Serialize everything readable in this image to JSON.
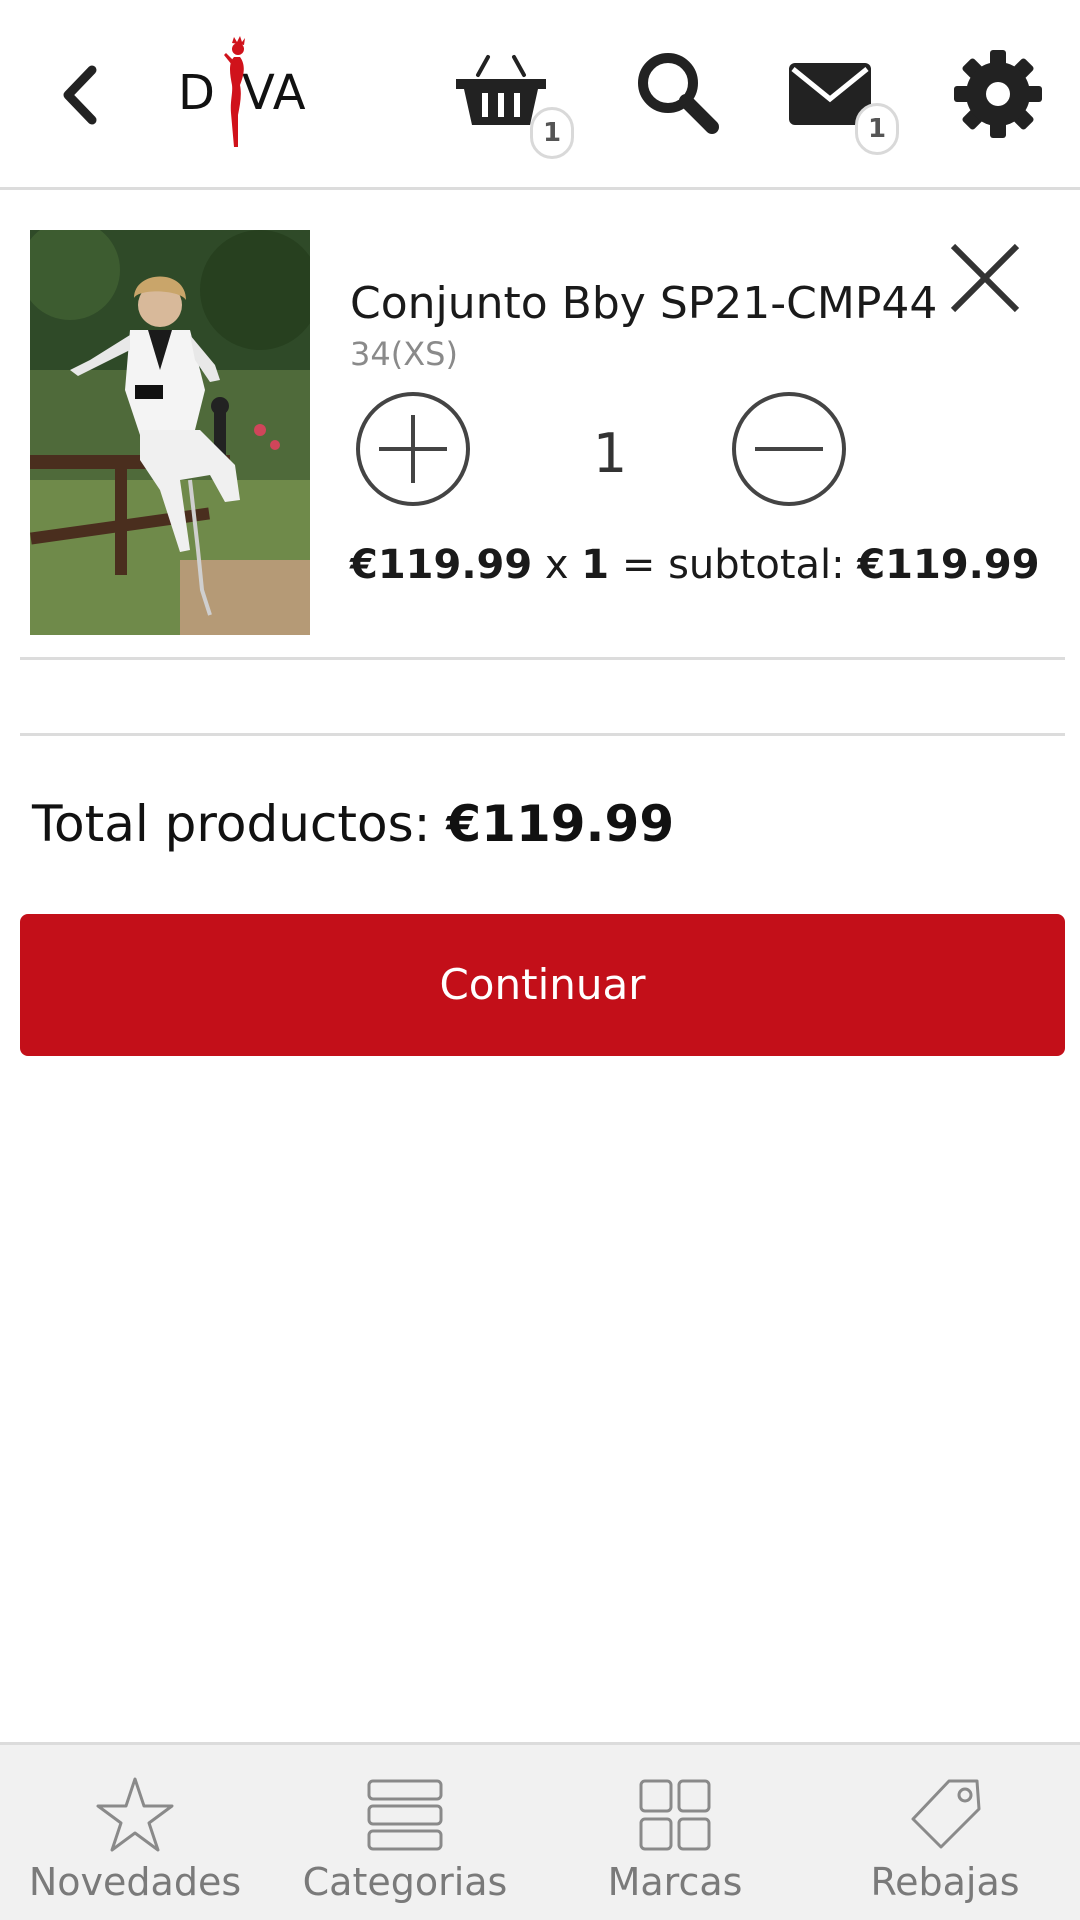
{
  "header": {
    "logo_text": [
      "D",
      "VA"
    ],
    "cart_badge": "1",
    "mail_badge": "1"
  },
  "cart_item": {
    "name": "Conjunto Bby SP21-CMP44",
    "size": "34(XS)",
    "quantity": "1",
    "unit_price": "€119.99",
    "times": "x",
    "qty_in_line": "1",
    "subtotal_label": "= subtotal:",
    "subtotal": "€119.99"
  },
  "summary": {
    "total_label": "Total productos:",
    "total_value": "€119.99",
    "continue_label": "Continuar"
  },
  "bottom_nav": [
    {
      "label": "Novedades",
      "icon": "star-icon"
    },
    {
      "label": "Categorias",
      "icon": "list-icon"
    },
    {
      "label": "Marcas",
      "icon": "grid-icon"
    },
    {
      "label": "Rebajas",
      "icon": "tag-icon"
    }
  ],
  "colors": {
    "accent": "#c30f19",
    "logo_red": "#d0121b"
  }
}
